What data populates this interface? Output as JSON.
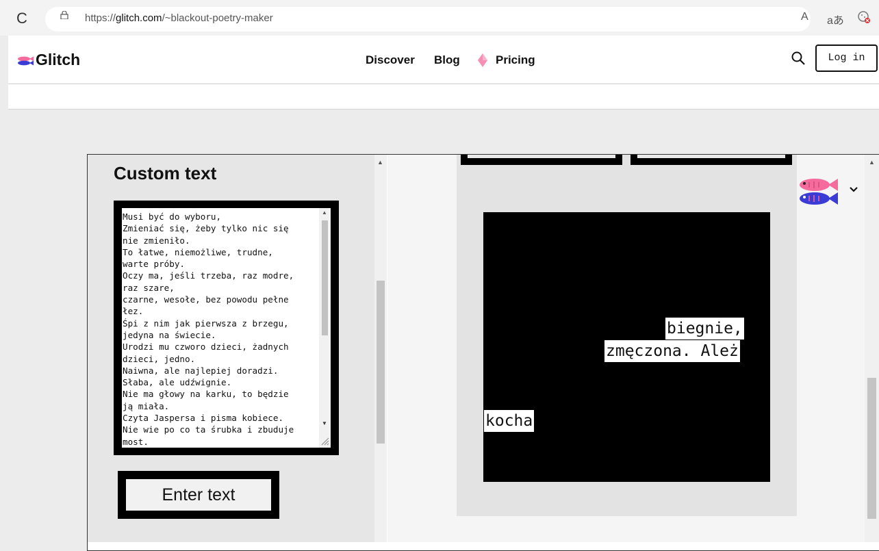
{
  "browser": {
    "url_prefix": "https://",
    "url_domain": "glitch.com",
    "url_path": "/~blackout-poetry-maker",
    "reload_glyph": "C",
    "read_aloud_glyph": "A",
    "translate_glyph": "aあ"
  },
  "header": {
    "logo_text": "Glitch",
    "nav": {
      "discover": "Discover",
      "blog": "Blog",
      "pricing": "Pricing"
    },
    "login_label": "Log in"
  },
  "app": {
    "custom_text_title": "Custom text",
    "textarea_value": "Musi być do wyboru,\nZmieniać się, żeby tylko nic się\nnie zmieniło.\nTo łatwe, niemożliwe, trudne,\nwarte próby.\nOczy ma, jeśli trzeba, raz modre,\nraz szare,\nczarne, wesołe, bez powodu pełne\nłez.\nŚpi z nim jak pierwsza z brzegu,\njedyna na świecie.\nUrodzi mu czworo dzieci, żadnych\ndzieci, jedno.\nNaiwna, ale najlepiej doradzi.\nSłaba, ale udźwignie.\nNie ma głowy na karku, to będzie\nją miała.\nCzyta Jaspersa i pisma kobiece.\nNie wie po co ta śrubka i zbuduje\nmost.",
    "enter_button_label": "Enter text",
    "poem_words": {
      "word1": "biegnie,",
      "word2": "zmęczona. Ależ",
      "word3": "kocha"
    }
  },
  "colors": {
    "accent_pink": "#f56b9b",
    "accent_blue": "#3b3bd6",
    "canvas_black": "#000000"
  },
  "icons": {
    "reload": "reload-icon",
    "lock": "lock-icon",
    "search": "search-icon",
    "gem": "gem-icon",
    "fish": "glitch-fish-icon",
    "chevron": "chevron-down-icon"
  }
}
